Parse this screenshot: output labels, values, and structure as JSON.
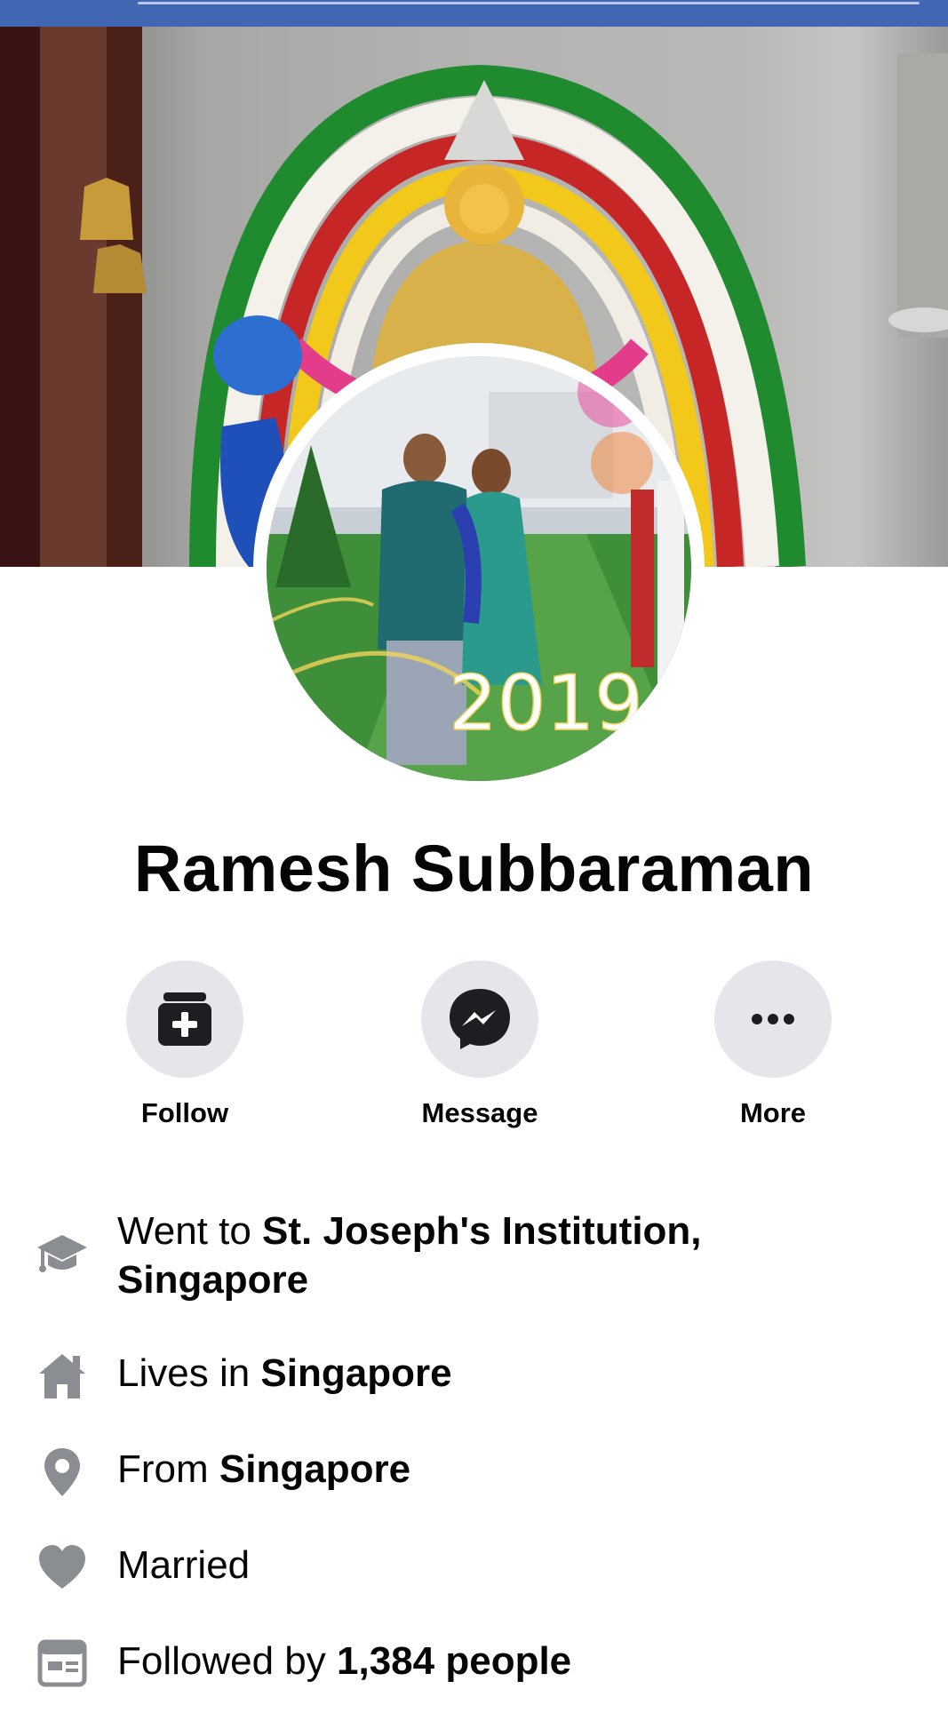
{
  "colors": {
    "topbar": "#4267b2",
    "button_bg": "#e4e6eb",
    "icon_gray": "#8a8d91",
    "text": "#050505"
  },
  "profile": {
    "name": "Ramesh Subbaraman",
    "avatar_badge_text": "2019"
  },
  "actions": [
    {
      "label": "Follow",
      "icon": "follow-icon"
    },
    {
      "label": "Message",
      "icon": "messenger-icon"
    },
    {
      "label": "More",
      "icon": "more-dots-icon"
    }
  ],
  "details": {
    "education": {
      "prefix": "Went to ",
      "value": "St. Joseph's Institution,",
      "value2": "Singapore",
      "icon": "graduation-cap-icon"
    },
    "lives": {
      "prefix": "Lives in ",
      "value": "Singapore",
      "icon": "home-icon"
    },
    "from": {
      "prefix": "From ",
      "value": "Singapore",
      "icon": "location-pin-icon"
    },
    "relationship": {
      "prefix": "Married",
      "icon": "heart-icon"
    },
    "followers": {
      "prefix": "Followed by ",
      "value": "1,384 people",
      "icon": "followers-card-icon"
    }
  }
}
